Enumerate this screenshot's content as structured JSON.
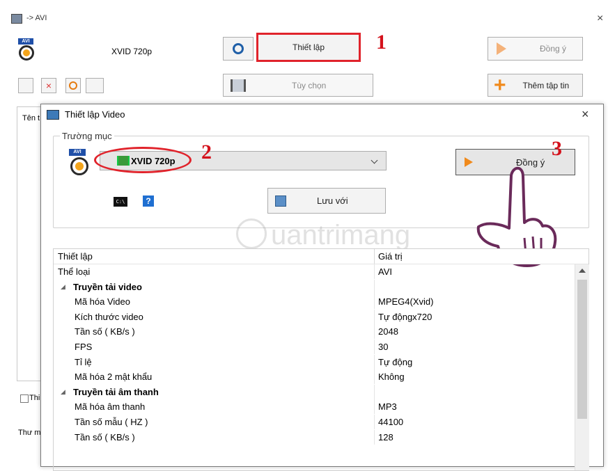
{
  "main": {
    "title": "-> AVI",
    "close": "×",
    "preset": "XVID 720p",
    "btn_settings": "Thiết lập",
    "btn_ok": "Đồng ý",
    "btn_options": "Tùy chọn",
    "btn_add": "Thêm tập tin",
    "col_name_partial": "Tên t",
    "check_partial": "Thi",
    "bottom_partial": "Thư m"
  },
  "dialog": {
    "title": "Thiết lập Video",
    "close": "×",
    "group_label": "Trường mục",
    "profile_value": "XVID 720p",
    "btn_ok": "Đồng ý",
    "btn_save_as": "Lưu với",
    "question_mark": "?",
    "table": {
      "col_setting": "Thiết lập",
      "col_value": "Giá trị",
      "rows": [
        {
          "name": "Thể loại",
          "value": "AVI",
          "kind": "plain"
        },
        {
          "name": "Truyền tải video",
          "value": "",
          "kind": "group"
        },
        {
          "name": "Mã hóa Video",
          "value": "MPEG4(Xvid)",
          "kind": "child"
        },
        {
          "name": "Kích thước video",
          "value": "Tự độngx720",
          "kind": "child"
        },
        {
          "name": "Tần số ( KB/s )",
          "value": "2048",
          "kind": "child"
        },
        {
          "name": "FPS",
          "value": "30",
          "kind": "child"
        },
        {
          "name": "Tỉ lệ",
          "value": "Tự động",
          "kind": "child"
        },
        {
          "name": "Mã hóa 2 mật khẩu",
          "value": "Không",
          "kind": "child"
        },
        {
          "name": "Truyền tải âm thanh",
          "value": "",
          "kind": "group"
        },
        {
          "name": "Mã hóa âm thanh",
          "value": "MP3",
          "kind": "child"
        },
        {
          "name": "Tần số mẫu ( HZ )",
          "value": "44100",
          "kind": "child"
        },
        {
          "name": "Tần số ( KB/s )",
          "value": "128",
          "kind": "child"
        }
      ]
    }
  },
  "annotations": {
    "step1": "1",
    "step2": "2",
    "step3": "3",
    "annotation_color": "#d4121c"
  },
  "watermark": {
    "text": "uantrimang"
  }
}
